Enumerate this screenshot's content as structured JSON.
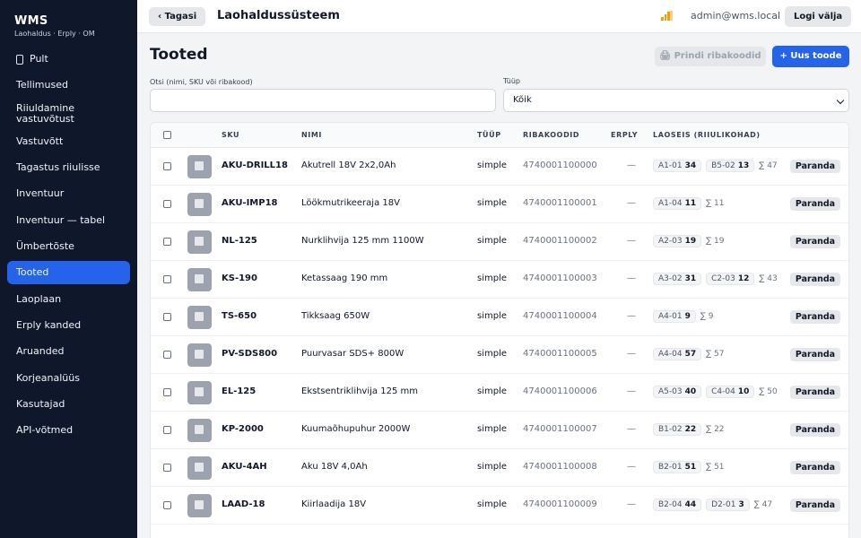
{
  "sidebar": {
    "brand": "WMS",
    "brand_sub": "Laohaldus · Erply · OM",
    "items": [
      {
        "label": "Pult",
        "icon": "phone-icon"
      },
      {
        "label": "Tellimused"
      },
      {
        "label": "Riiuldamine vastuvõtust"
      },
      {
        "label": "Vastuvõtt"
      },
      {
        "label": "Tagastus riiulisse"
      },
      {
        "label": "Inventuur"
      },
      {
        "label": "Inventuur — tabel"
      },
      {
        "label": "Ümbertõste"
      },
      {
        "label": "Tooted",
        "active": true
      },
      {
        "label": "Laoplaan"
      },
      {
        "label": "Erply kanded"
      },
      {
        "label": "Aruanded"
      },
      {
        "label": "Korjeanalüüs"
      },
      {
        "label": "Kasutajad"
      },
      {
        "label": "API-võtmed"
      }
    ]
  },
  "topbar": {
    "back_label": "‹ Tagasi",
    "title": "Laohaldussüsteem",
    "status_icon": "signal-bars-icon",
    "user": "admin@wms.local",
    "logout_label": "Logi välja"
  },
  "page": {
    "title": "Tooted",
    "print_label": "🖨 Prindi ribakoodid",
    "new_label": "+ Uus toode",
    "search_label": "Otsi (nimi, SKU või ribakood)",
    "search_value": "",
    "type_label": "Tüüp",
    "type_value": "Kõik"
  },
  "table": {
    "headers": {
      "sku": "SKU",
      "name": "NIMI",
      "type": "TÜÜP",
      "barcodes": "RIBAKOODID",
      "erply": "ERPLY",
      "stock": "LAOSEIS (RIIULIKOHAD)"
    },
    "action_label": "Paranda",
    "rows": [
      {
        "sku": "AKU-DRILL18",
        "name": "Akutrell 18V 2x2,0Ah",
        "type": "simple",
        "barcode": "4740001100000",
        "erply": "—",
        "locations": [
          {
            "loc": "A1-01",
            "qty": "34"
          },
          {
            "loc": "B5-02",
            "qty": "13"
          }
        ],
        "total": "∑ 47"
      },
      {
        "sku": "AKU-IMP18",
        "name": "Löökmutrikeeraja 18V",
        "type": "simple",
        "barcode": "4740001100001",
        "erply": "—",
        "locations": [
          {
            "loc": "A1-04",
            "qty": "11"
          }
        ],
        "total": "∑ 11"
      },
      {
        "sku": "NL-125",
        "name": "Nurklihvija 125 mm 1100W",
        "type": "simple",
        "barcode": "4740001100002",
        "erply": "—",
        "locations": [
          {
            "loc": "A2-03",
            "qty": "19"
          }
        ],
        "total": "∑ 19"
      },
      {
        "sku": "KS-190",
        "name": "Ketassaag 190 mm",
        "type": "simple",
        "barcode": "4740001100003",
        "erply": "—",
        "locations": [
          {
            "loc": "A3-02",
            "qty": "31"
          },
          {
            "loc": "C2-03",
            "qty": "12"
          }
        ],
        "total": "∑ 43"
      },
      {
        "sku": "TS-650",
        "name": "Tikksaag 650W",
        "type": "simple",
        "barcode": "4740001100004",
        "erply": "—",
        "locations": [
          {
            "loc": "A4-01",
            "qty": "9"
          }
        ],
        "total": "∑ 9"
      },
      {
        "sku": "PV-SDS800",
        "name": "Puurvasar SDS+ 800W",
        "type": "simple",
        "barcode": "4740001100005",
        "erply": "—",
        "locations": [
          {
            "loc": "A4-04",
            "qty": "57"
          }
        ],
        "total": "∑ 57"
      },
      {
        "sku": "EL-125",
        "name": "Ekstsentriklihvija 125 mm",
        "type": "simple",
        "barcode": "4740001100006",
        "erply": "—",
        "locations": [
          {
            "loc": "A5-03",
            "qty": "40"
          },
          {
            "loc": "C4-04",
            "qty": "10"
          }
        ],
        "total": "∑ 50"
      },
      {
        "sku": "KP-2000",
        "name": "Kuumaõhupuhur 2000W",
        "type": "simple",
        "barcode": "4740001100007",
        "erply": "—",
        "locations": [
          {
            "loc": "B1-02",
            "qty": "22"
          }
        ],
        "total": "∑ 22"
      },
      {
        "sku": "AKU-4AH",
        "name": "Aku 18V 4,0Ah",
        "type": "simple",
        "barcode": "4740001100008",
        "erply": "—",
        "locations": [
          {
            "loc": "B2-01",
            "qty": "51"
          }
        ],
        "total": "∑ 51"
      },
      {
        "sku": "LAAD-18",
        "name": "Kiirlaadija 18V",
        "type": "simple",
        "barcode": "4740001100009",
        "erply": "—",
        "locations": [
          {
            "loc": "B2-04",
            "qty": "44"
          },
          {
            "loc": "D2-01",
            "qty": "3"
          }
        ],
        "total": "∑ 47"
      }
    ]
  }
}
